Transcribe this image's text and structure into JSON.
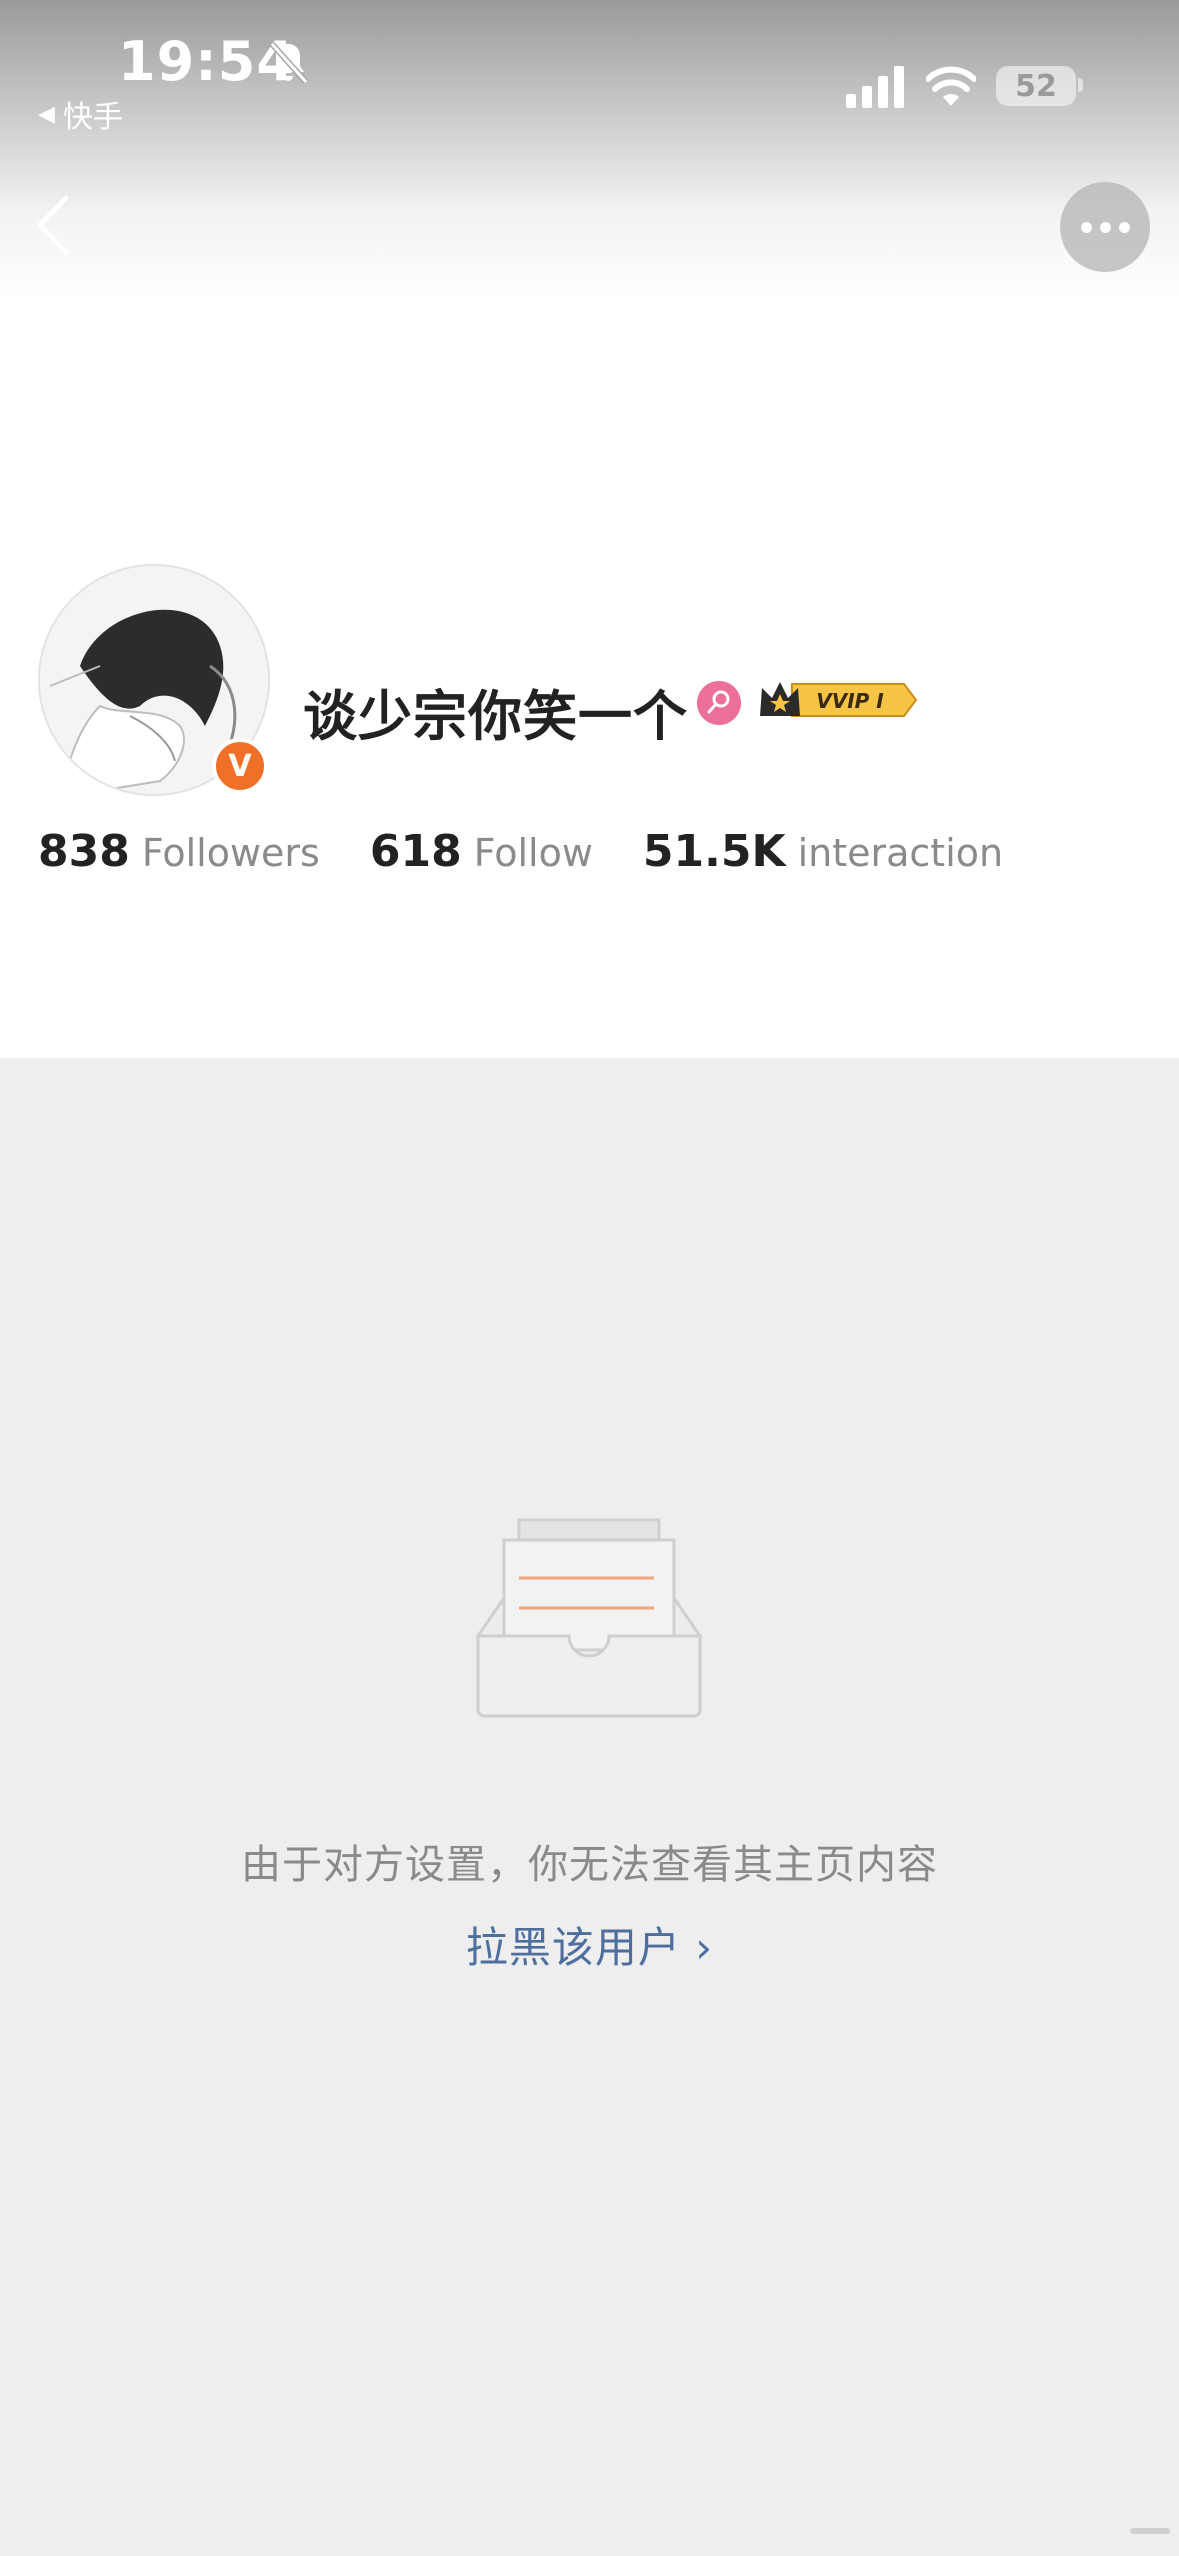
{
  "status_bar": {
    "time": "19:54",
    "back_app_label": "快手",
    "battery_level": "52",
    "icons": [
      "bell-muted-icon",
      "signal-icon",
      "wifi-icon",
      "battery-icon"
    ]
  },
  "nav": {
    "back_icon": "chevron-left-icon",
    "more_icon": "more-dots-icon"
  },
  "profile": {
    "username": "谈少宗你笑一个",
    "verified_badge": "V",
    "gender_icon": "female-icon",
    "vip_label": "VVIP I",
    "stats": [
      {
        "value": "838",
        "label": "Followers"
      },
      {
        "value": "618",
        "label": "Follow"
      },
      {
        "value": "51.5K",
        "label": "interaction"
      }
    ]
  },
  "empty_state": {
    "icon": "empty-inbox-icon",
    "message": "由于对方设置，你无法查看其主页内容",
    "block_link": "拉黑该用户 ›"
  },
  "colors": {
    "accent_orange": "#f07027",
    "link_blue": "#4e6e9e",
    "gender_pink": "#ec6f9c",
    "vip_gold": "#f7c445",
    "empty_bg": "#eeeeee"
  }
}
